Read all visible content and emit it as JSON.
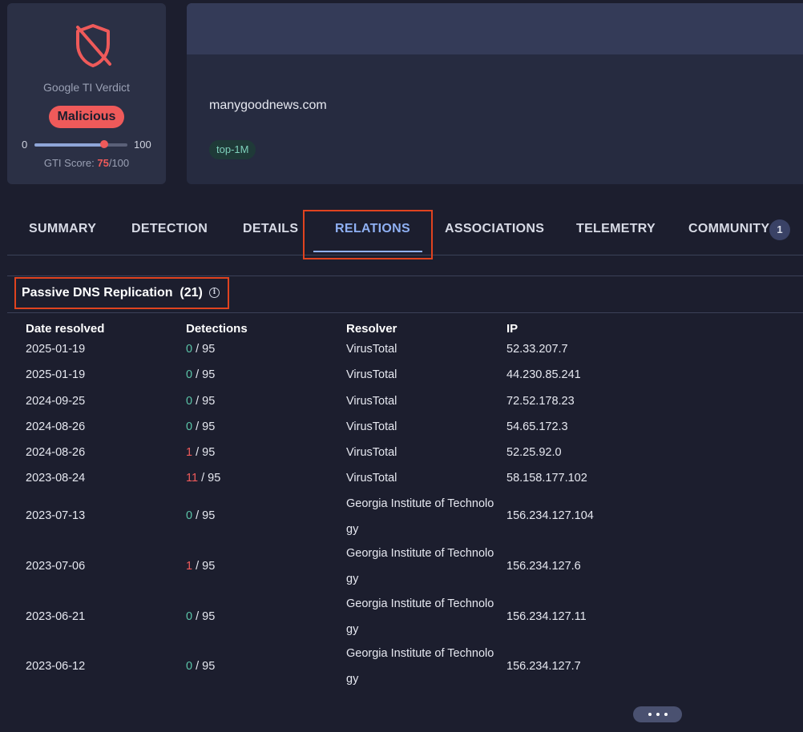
{
  "verdict": {
    "icon": "shield-off-icon",
    "label": "Google TI Verdict",
    "badge": "Malicious",
    "scale_min": "0",
    "scale_max": "100",
    "score_label": "GTI Score: ",
    "score_value": "75",
    "score_total": "/100",
    "score_fraction": 0.75,
    "colors": {
      "malicious": "#ef5a5a",
      "card": "#2b3045"
    }
  },
  "header": {
    "domain": "manygoodnews.com",
    "tag": "top-1M"
  },
  "tabs": [
    {
      "label": "SUMMARY"
    },
    {
      "label": "DETECTION"
    },
    {
      "label": "DETAILS"
    },
    {
      "label": "RELATIONS",
      "active": true
    },
    {
      "label": "ASSOCIATIONS"
    },
    {
      "label": "TELEMETRY"
    },
    {
      "label": "COMMUNITY",
      "badge": "1"
    }
  ],
  "section": {
    "title": "Passive DNS Replication",
    "count": "(21)",
    "info_icon": "info-icon"
  },
  "table": {
    "columns": [
      "Date resolved",
      "Detections",
      "Resolver",
      "IP"
    ],
    "rows": [
      {
        "date": "2025-01-19",
        "det": "0",
        "total": "/ 95",
        "resolver": "VirusTotal",
        "ip": "52.33.207.7"
      },
      {
        "date": "2025-01-19",
        "det": "0",
        "total": "/ 95",
        "resolver": "VirusTotal",
        "ip": "44.230.85.241"
      },
      {
        "date": "2024-09-25",
        "det": "0",
        "total": "/ 95",
        "resolver": "VirusTotal",
        "ip": "72.52.178.23"
      },
      {
        "date": "2024-08-26",
        "det": "0",
        "total": "/ 95",
        "resolver": "VirusTotal",
        "ip": "54.65.172.3"
      },
      {
        "date": "2024-08-26",
        "det": "1",
        "total": "/ 95",
        "resolver": "VirusTotal",
        "ip": "52.25.92.0"
      },
      {
        "date": "2023-08-24",
        "det": "11",
        "total": "/ 95",
        "resolver": "VirusTotal",
        "ip": "58.158.177.102"
      },
      {
        "date": "2023-07-13",
        "det": "0",
        "total": "/ 95",
        "resolver": "Georgia Institute of Technology",
        "ip": "156.234.127.104"
      },
      {
        "date": "2023-07-06",
        "det": "1",
        "total": "/ 95",
        "resolver": "Georgia Institute of Technology",
        "ip": "156.234.127.6"
      },
      {
        "date": "2023-06-21",
        "det": "0",
        "total": "/ 95",
        "resolver": "Georgia Institute of Technology",
        "ip": "156.234.127.11"
      },
      {
        "date": "2023-06-12",
        "det": "0",
        "total": "/ 95",
        "resolver": "Georgia Institute of Technology",
        "ip": "156.234.127.7"
      }
    ]
  },
  "more_button": {
    "icon": "more-horizontal-icon"
  }
}
